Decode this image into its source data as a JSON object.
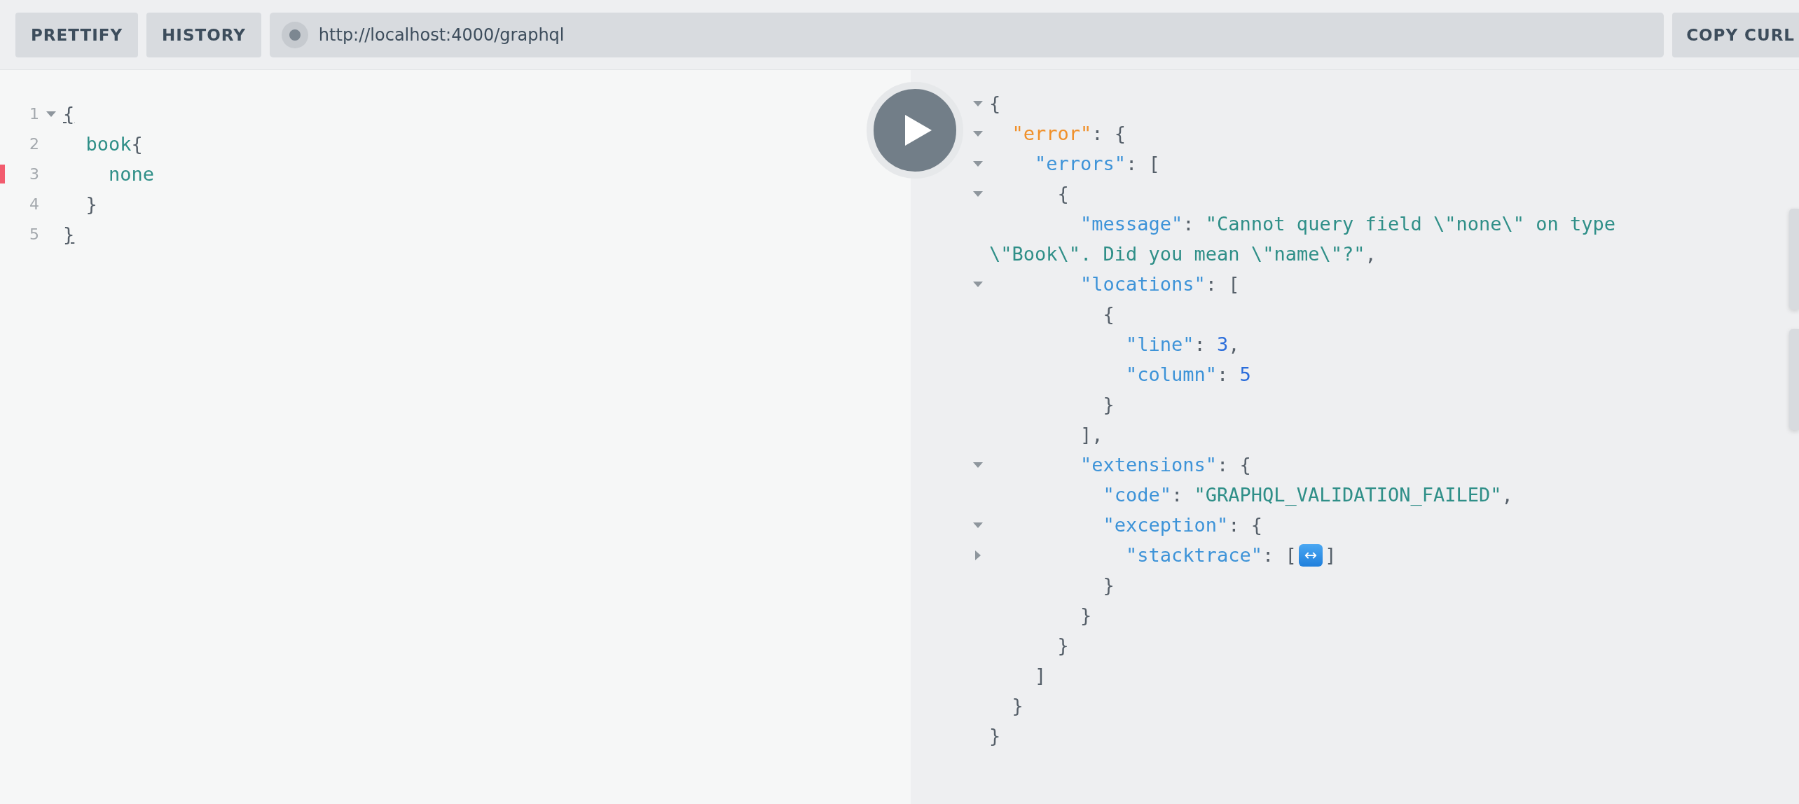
{
  "toolbar": {
    "buttons": [
      {
        "label": "PRETTIFY"
      },
      {
        "label": "HISTORY"
      }
    ],
    "url": "http://localhost:4000/graphql",
    "copy_button": "COPY CURL"
  },
  "editor": {
    "lines": [
      {
        "number": "1",
        "expanded": true,
        "error": false,
        "tokens": [
          {
            "kind": "match",
            "text": "{"
          }
        ],
        "children": [
          {
            "number": "2",
            "error": false,
            "tokens": [
              {
                "kind": "field",
                "text": "book"
              },
              {
                "kind": "punct",
                "text": "{"
              }
            ],
            "children": [
              {
                "number": "3",
                "error": true,
                "tokens": [
                  {
                    "kind": "field",
                    "text": "none"
                  }
                ]
              }
            ]
          },
          {
            "number": "4",
            "error": false,
            "tokens": [
              {
                "kind": "punct",
                "text": "}"
              }
            ]
          }
        ]
      },
      {
        "number": "5",
        "error": false,
        "tokens": [
          {
            "kind": "match",
            "text": "}"
          }
        ]
      }
    ]
  },
  "result": {
    "lines": [
      {
        "expanded": true,
        "tokens": [
          {
            "kind": "punct",
            "text": "{"
          }
        ],
        "children": [
          {
            "expanded": true,
            "tokens": [
              {
                "kind": "error-key",
                "text": "\"error\""
              },
              {
                "kind": "punct",
                "text": ": {"
              }
            ],
            "children": [
              {
                "expanded": true,
                "tokens": [
                  {
                    "kind": "key",
                    "text": "\"errors\""
                  },
                  {
                    "kind": "punct",
                    "text": ": ["
                  }
                ],
                "children": [
                  {
                    "expanded": true,
                    "tokens": [
                      {
                        "kind": "punct",
                        "text": "{"
                      }
                    ],
                    "children": [
                      {
                        "tokens": [
                          {
                            "kind": "key",
                            "text": "\"message\""
                          },
                          {
                            "kind": "punct",
                            "text": ": "
                          },
                          {
                            "kind": "string",
                            "text": "\"Cannot query field \\\"none\\\" on type"
                          }
                        ],
                        "wrap": [
                          {
                            "kind": "string",
                            "text": "\\\"Book\\\". Did you mean \\\"name\\\"?\""
                          },
                          {
                            "kind": "punct",
                            "text": ","
                          }
                        ]
                      },
                      {
                        "expanded": true,
                        "tokens": [
                          {
                            "kind": "key",
                            "text": "\"locations\""
                          },
                          {
                            "kind": "punct",
                            "text": ": ["
                          }
                        ],
                        "children": [
                          {
                            "tokens": [
                              {
                                "kind": "punct",
                                "text": "{"
                              }
                            ],
                            "children": [
                              {
                                "tokens": [
                                  {
                                    "kind": "key",
                                    "text": "\"line\""
                                  },
                                  {
                                    "kind": "punct",
                                    "text": ": "
                                  },
                                  {
                                    "kind": "number",
                                    "text": "3"
                                  },
                                  {
                                    "kind": "punct",
                                    "text": ","
                                  }
                                ]
                              },
                              {
                                "tokens": [
                                  {
                                    "kind": "key",
                                    "text": "\"column\""
                                  },
                                  {
                                    "kind": "punct",
                                    "text": ": "
                                  },
                                  {
                                    "kind": "number",
                                    "text": "5"
                                  }
                                ]
                              }
                            ]
                          },
                          {
                            "tokens": [
                              {
                                "kind": "punct",
                                "text": "}"
                              }
                            ]
                          }
                        ]
                      },
                      {
                        "tokens": [
                          {
                            "kind": "punct",
                            "text": "],"
                          }
                        ]
                      },
                      {
                        "expanded": true,
                        "tokens": [
                          {
                            "kind": "key",
                            "text": "\"extensions\""
                          },
                          {
                            "kind": "punct",
                            "text": ": {"
                          }
                        ],
                        "children": [
                          {
                            "tokens": [
                              {
                                "kind": "key",
                                "text": "\"code\""
                              },
                              {
                                "kind": "punct",
                                "text": ": "
                              },
                              {
                                "kind": "string",
                                "text": "\"GRAPHQL_VALIDATION_FAILED\""
                              },
                              {
                                "kind": "punct",
                                "text": ","
                              }
                            ]
                          },
                          {
                            "expanded": true,
                            "tokens": [
                              {
                                "kind": "key",
                                "text": "\"exception\""
                              },
                              {
                                "kind": "punct",
                                "text": ": {"
                              }
                            ],
                            "children": [
                              {
                                "expanded": false,
                                "tokens": [
                                  {
                                    "kind": "key",
                                    "text": "\"stacktrace\""
                                  },
                                  {
                                    "kind": "punct",
                                    "text": ": ["
                                  },
                                  {
                                    "kind": "expander",
                                    "text": "↔"
                                  },
                                  {
                                    "kind": "punct",
                                    "text": "]"
                                  }
                                ]
                              }
                            ]
                          },
                          {
                            "tokens": [
                              {
                                "kind": "punct",
                                "text": "}"
                              }
                            ]
                          }
                        ]
                      },
                      {
                        "tokens": [
                          {
                            "kind": "punct",
                            "text": "}"
                          }
                        ]
                      }
                    ]
                  },
                  {
                    "tokens": [
                      {
                        "kind": "punct",
                        "text": "}"
                      }
                    ]
                  }
                ]
              },
              {
                "tokens": [
                  {
                    "kind": "punct",
                    "text": "]"
                  }
                ]
              }
            ]
          },
          {
            "tokens": [
              {
                "kind": "punct",
                "text": "}"
              }
            ]
          }
        ]
      },
      {
        "tokens": [
          {
            "kind": "punct",
            "text": "}"
          }
        ]
      }
    ]
  },
  "side_tabs": [
    {
      "kind": "tab"
    },
    {
      "kind": "tab"
    }
  ]
}
